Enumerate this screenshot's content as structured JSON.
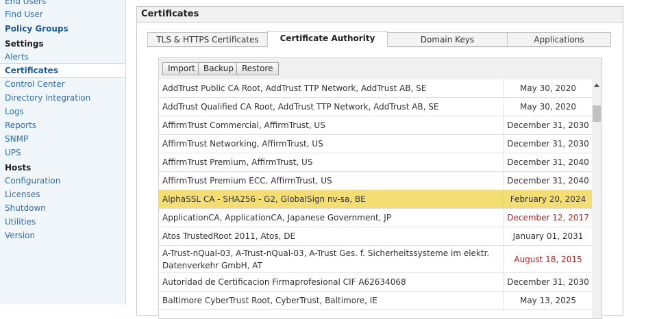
{
  "sidebar": {
    "items": [
      {
        "label": "End Users",
        "style": "link"
      },
      {
        "label": "Find User",
        "style": "link"
      },
      {
        "label": "Policy Groups",
        "style": "bold"
      },
      {
        "label": "Settings",
        "style": "heading"
      },
      {
        "label": "Alerts",
        "style": "link"
      },
      {
        "label": "Certificates",
        "style": "selected"
      },
      {
        "label": "Control Center",
        "style": "link"
      },
      {
        "label": "Directory Integration",
        "style": "link"
      },
      {
        "label": "Logs",
        "style": "link"
      },
      {
        "label": "Reports",
        "style": "link"
      },
      {
        "label": "SNMP",
        "style": "link"
      },
      {
        "label": "UPS",
        "style": "link"
      },
      {
        "label": "Hosts",
        "style": "heading"
      },
      {
        "label": "Configuration",
        "style": "link"
      },
      {
        "label": "Licenses",
        "style": "link"
      },
      {
        "label": "Shutdown",
        "style": "link"
      },
      {
        "label": "Utilities",
        "style": "link"
      },
      {
        "label": "Version",
        "style": "link"
      }
    ]
  },
  "panel": {
    "title": "Certificates"
  },
  "tabs": [
    {
      "label": "TLS & HTTPS Certificates",
      "active": false
    },
    {
      "label": "Certificate Authority",
      "active": true
    },
    {
      "label": "Domain Keys",
      "active": false
    },
    {
      "label": "Applications",
      "active": false
    }
  ],
  "toolbar": {
    "import_label": "Import",
    "backup_label": "Backup",
    "restore_label": "Restore"
  },
  "colors": {
    "highlight": "#f4de74",
    "expired": "#b22222",
    "link": "#2e6da4"
  },
  "certificates": [
    {
      "name": "AddTrust Public CA Root, AddTrust TTP Network, AddTrust AB, SE",
      "expires": "May 30, 2020",
      "expired": false,
      "highlight": false
    },
    {
      "name": "AddTrust Qualified CA Root, AddTrust TTP Network, AddTrust AB, SE",
      "expires": "May 30, 2020",
      "expired": false,
      "highlight": false
    },
    {
      "name": "AffirmTrust Commercial, AffirmTrust, US",
      "expires": "December 31, 2030",
      "expired": false,
      "highlight": false
    },
    {
      "name": "AffirmTrust Networking, AffirmTrust, US",
      "expires": "December 31, 2030",
      "expired": false,
      "highlight": false
    },
    {
      "name": "AffirmTrust Premium, AffirmTrust, US",
      "expires": "December 31, 2040",
      "expired": false,
      "highlight": false
    },
    {
      "name": "AffirmTrust Premium ECC, AffirmTrust, US",
      "expires": "December 31, 2040",
      "expired": false,
      "highlight": false
    },
    {
      "name": "AlphaSSL CA - SHA256 - G2, GlobalSign nv-sa, BE",
      "expires": "February 20, 2024",
      "expired": false,
      "highlight": true
    },
    {
      "name": "ApplicationCA, ApplicationCA, Japanese Government, JP",
      "expires": "December 12, 2017",
      "expired": true,
      "highlight": false
    },
    {
      "name": "Atos TrustedRoot 2011, Atos, DE",
      "expires": "January 01, 2031",
      "expired": false,
      "highlight": false
    },
    {
      "name": "A-Trust-nQual-03, A-Trust-nQual-03, A-Trust Ges. f. Sicherheitssysteme im elektr. Datenverkehr GmbH, AT",
      "expires": "August 18, 2015",
      "expired": true,
      "highlight": false
    },
    {
      "name": "Autoridad de Certificacion Firmaprofesional CIF A62634068",
      "expires": "December 31, 2030",
      "expired": false,
      "highlight": false
    },
    {
      "name": "Baltimore CyberTrust Root, CyberTrust, Baltimore, IE",
      "expires": "May 13, 2025",
      "expired": false,
      "highlight": false
    }
  ]
}
